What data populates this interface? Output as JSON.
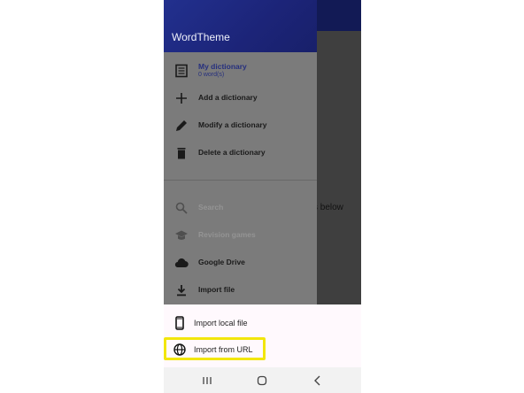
{
  "drawer": {
    "app_title": "WordTheme",
    "dictionary": {
      "label": "My dictionary",
      "count": "0 word(s)",
      "icon": "dictionary-book-icon"
    },
    "items": [
      {
        "label": "Add a dictionary",
        "icon": "plus-icon",
        "enabled": true
      },
      {
        "label": "Modify a dictionary",
        "icon": "pencil-icon",
        "enabled": true
      },
      {
        "label": "Delete a dictionary",
        "icon": "trash-icon",
        "enabled": true
      },
      {
        "label": "Search",
        "icon": "search-icon",
        "enabled": false
      },
      {
        "label": "Revision games",
        "icon": "graduation-cap-icon",
        "enabled": false
      },
      {
        "label": "Google Drive",
        "icon": "cloud-icon",
        "enabled": true
      },
      {
        "label": "Import file",
        "icon": "download-icon",
        "enabled": true
      }
    ]
  },
  "background": {
    "partial_text": "ks below"
  },
  "sheet": {
    "options": [
      {
        "label": "Import local file",
        "icon": "phone-icon"
      },
      {
        "label": "Import from URL",
        "icon": "globe-icon",
        "highlighted": true
      }
    ]
  },
  "colors": {
    "header": "#1c2478",
    "accent_text": "#26307e",
    "highlight": "#f2e60c",
    "scrim": "#3f3f3f"
  }
}
